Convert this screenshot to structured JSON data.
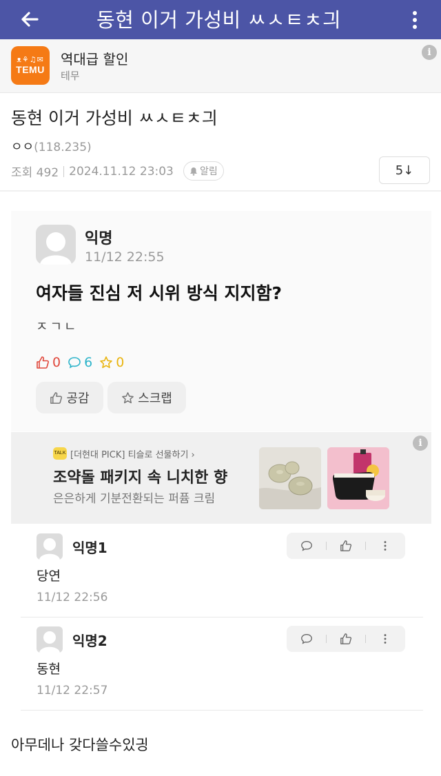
{
  "topbar": {
    "back_icon": "arrow-left-icon",
    "title": "동현 이거 가성비 ㅆㅅㅌㅊ긔",
    "more_icon": "more-vertical-icon"
  },
  "ad_banner": {
    "logo_glyphs": "ᴥ⚘♫✉",
    "logo_word": "TEMU",
    "title": "역대급 할인",
    "subtitle": "테무",
    "info_label": "i"
  },
  "post": {
    "title": "동현 이거 가성비 ㅆㅅㅌㅊ긔",
    "author": "ㅇㅇ",
    "author_ip": "(118.235)",
    "views": "조회 492",
    "datetime": "2024.11.12 23:03",
    "alarm_label": "알림",
    "comment_count": "5↓"
  },
  "embedded": {
    "author": "익명",
    "time": "11/12 22:55",
    "title": "여자들 진심 저 시위 방식 지지함?",
    "body": "ㅈㄱㄴ",
    "likes": "0",
    "comments": "6",
    "stars": "0",
    "like_button": "공감",
    "scrap_button": "스크랩"
  },
  "native_ad": {
    "badge": "TALK",
    "label": "[더현대 PICK] 티슬로 선물하기 ›",
    "title": "조약돌 패키지 속 니치한 향",
    "subtitle": "은은하게 기분전환되는 퍼퓸 크림",
    "info_label": "i"
  },
  "comments": [
    {
      "author": "익명1",
      "text": "당연",
      "time": "11/12 22:56"
    },
    {
      "author": "익명2",
      "text": "동현",
      "time": "11/12 22:57"
    }
  ],
  "footer_text": "아무데나 갖다쓸수있긩",
  "colors": {
    "topbar": "#4c55a6",
    "temu": "#f57a15",
    "like": "#e0473b",
    "comment": "#2bb3c9",
    "star": "#e9b40f"
  }
}
